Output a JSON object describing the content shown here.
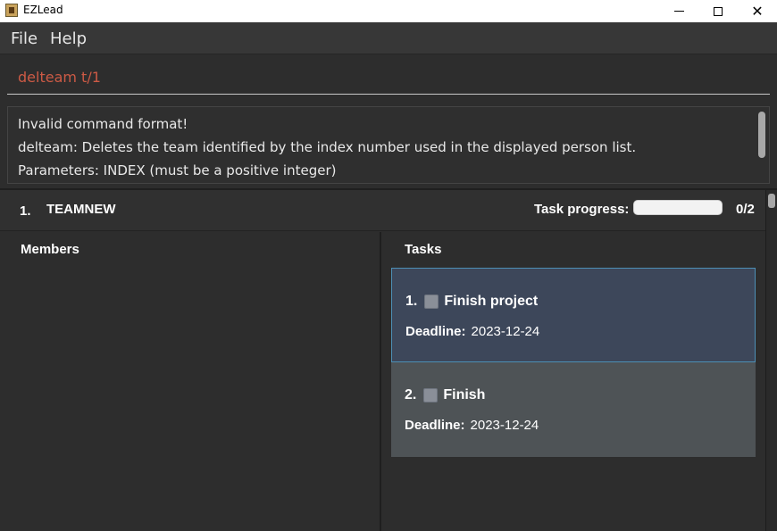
{
  "window": {
    "title": "EZLead"
  },
  "menu": {
    "file": "File",
    "help": "Help"
  },
  "command": {
    "value": "delteam t/1"
  },
  "result": {
    "line1": "Invalid command format!",
    "line2": "delteam: Deletes the team identified by the index number used in the displayed person list.",
    "line3": "Parameters: INDEX (must be a positive integer)"
  },
  "team": {
    "index": "1.",
    "name": "TEAMNEW",
    "progress_label": "Task progress:",
    "progress_fraction": 0,
    "progress_count": "0/2",
    "members_title": "Members",
    "tasks_title": "Tasks",
    "tasks": [
      {
        "number": "1.",
        "title": "Finish project",
        "deadline_label": "Deadline:",
        "deadline": "2023-12-24"
      },
      {
        "number": "2.",
        "title": "Finish",
        "deadline_label": "Deadline:",
        "deadline": "2023-12-24"
      }
    ]
  },
  "colors": {
    "command_text": "#cc5a45",
    "selected_card": "#3d475a",
    "card": "#4e5356"
  }
}
